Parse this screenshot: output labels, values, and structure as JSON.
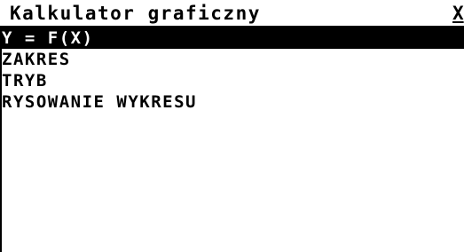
{
  "window": {
    "title": "Kalkulator graficzny",
    "close_label": "X"
  },
  "menu": {
    "items": [
      {
        "label": "Y = F(X)",
        "selected": true
      },
      {
        "label": "ZAKRES",
        "selected": false
      },
      {
        "label": "TRYB",
        "selected": false
      },
      {
        "label": "RYSOWANIE WYKRESU",
        "selected": false
      }
    ]
  },
  "colors": {
    "background": "#ffffff",
    "foreground": "#000000",
    "highlight_bg": "#000000",
    "highlight_fg": "#ffffff"
  }
}
